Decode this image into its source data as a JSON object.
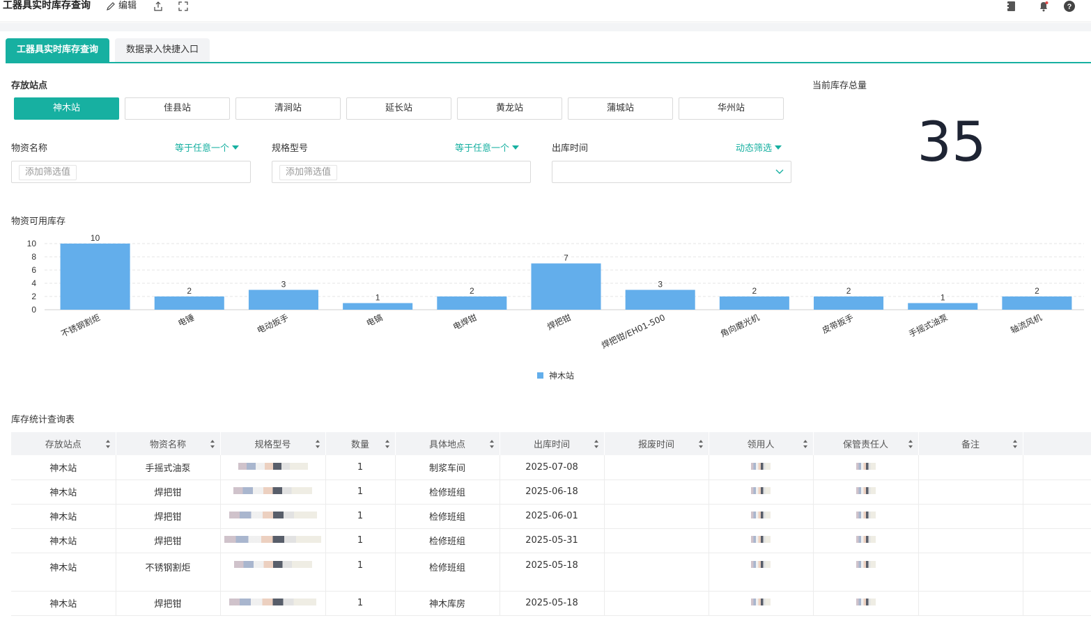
{
  "topbar": {
    "title": "工器具实时库存查询",
    "edit_label": "编辑"
  },
  "tabs": [
    {
      "label": "工器具实时库存查询"
    },
    {
      "label": "数据录入快捷入口"
    }
  ],
  "stations": {
    "label": "存放站点",
    "items": [
      "神木站",
      "佳县站",
      "清涧站",
      "延长站",
      "黄龙站",
      "蒲城站",
      "华州站"
    ],
    "selected": "神木站"
  },
  "filters": {
    "material": {
      "label": "物资名称",
      "mode": "等于任意一个",
      "placeholder": "添加筛选值"
    },
    "spec": {
      "label": "规格型号",
      "mode": "等于任意一个",
      "placeholder": "添加筛选值"
    },
    "outtime": {
      "label": "出库时间",
      "mode": "动态筛选"
    }
  },
  "total": {
    "label": "当前库存总量",
    "value": "35"
  },
  "chart_title": "物资可用库存",
  "chart_data": {
    "type": "bar",
    "categories": [
      "不锈钢割炬",
      "电锤",
      "电动扳手",
      "电镐",
      "电焊钳",
      "焊把钳",
      "焊把钳/EH01-500",
      "角向磨光机",
      "皮带扳手",
      "手摇式油泵",
      "轴流风机"
    ],
    "series": [
      {
        "name": "神木站",
        "values": [
          10,
          2,
          3,
          1,
          2,
          7,
          3,
          2,
          2,
          1,
          2
        ],
        "color": "#63aeeb"
      }
    ],
    "yticks": [
      0,
      2,
      4,
      6,
      8,
      10
    ],
    "ylim": [
      0,
      10
    ],
    "legend": "bottom-center",
    "grid": true
  },
  "table": {
    "title": "库存统计查询表",
    "columns": [
      "存放站点",
      "物资名称",
      "规格型号",
      "数量",
      "具体地点",
      "出库时间",
      "报废时间",
      "领用人",
      "保管责任人",
      "备注"
    ],
    "rows": [
      {
        "station": "神木站",
        "name": "手摇式油泵",
        "qty": "1",
        "place": "制浆车间",
        "out": "2025-07-08"
      },
      {
        "station": "神木站",
        "name": "焊把钳",
        "qty": "1",
        "place": "检修班组",
        "out": "2025-06-18"
      },
      {
        "station": "神木站",
        "name": "焊把钳",
        "qty": "1",
        "place": "检修班组",
        "out": "2025-06-01"
      },
      {
        "station": "神木站",
        "name": "焊把钳",
        "qty": "1",
        "place": "检修班组",
        "out": "2025-05-31"
      },
      {
        "station": "神木站",
        "name": "不锈钢割炬",
        "qty": "1",
        "place": "检修班组",
        "out": "2025-05-18"
      },
      {
        "station": "神木站",
        "name": "焊把钳",
        "qty": "1",
        "place": "神木库房",
        "out": "2025-05-18"
      }
    ]
  },
  "colors": {
    "accent": "#17b0a1",
    "bar": "#63aeeb"
  }
}
